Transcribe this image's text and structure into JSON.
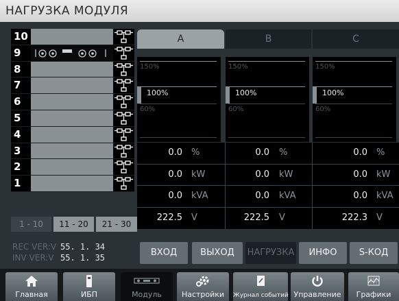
{
  "title": "НАГРУЗКА МОДУЛЯ",
  "modules": [
    {
      "num": "10",
      "active": false
    },
    {
      "num": "9",
      "active": true
    },
    {
      "num": "8",
      "active": false
    },
    {
      "num": "7",
      "active": false
    },
    {
      "num": "6",
      "active": false
    },
    {
      "num": "5",
      "active": false
    },
    {
      "num": "4",
      "active": false
    },
    {
      "num": "3",
      "active": false
    },
    {
      "num": "2",
      "active": false
    },
    {
      "num": "1",
      "active": false
    }
  ],
  "pager": {
    "p1": "1 - 10",
    "p2": "11 - 20",
    "p3": "21 - 30"
  },
  "phases": {
    "a": "A",
    "b": "B",
    "c": "C"
  },
  "gauge": {
    "high": "150%",
    "mid": "100%",
    "low": "60%"
  },
  "measurements": [
    {
      "unit": "%",
      "a": "0.0",
      "b": "0.0",
      "c": "0.0"
    },
    {
      "unit": "kW",
      "a": "0.0",
      "b": "0.0",
      "c": "0.0"
    },
    {
      "unit": "kVA",
      "a": "0.0",
      "b": "0.0",
      "c": "0.0"
    },
    {
      "unit": "V",
      "a": "222.5",
      "b": "222.5",
      "c": "222.3"
    }
  ],
  "version": {
    "rec_label": "REC VER:V",
    "rec_value": "55.  1. 34",
    "inv_label": "INV VER:V",
    "inv_value": "55.  1. 35"
  },
  "nav": {
    "input": "ВХОД",
    "output": "ВЫХОД",
    "load": "НАГРУЗКА",
    "info": "ИНФО",
    "scode": "S-КОД"
  },
  "tabs": {
    "home": "Главная",
    "ups": "ИБП",
    "module": "Модуль",
    "settings": "Настройки",
    "log": "Журнал событий",
    "control": "Управление",
    "graphs": "Графики"
  },
  "colors": {
    "background": "#2a3236",
    "selected_tab": "#0b0d0e",
    "button": "#646d71"
  }
}
